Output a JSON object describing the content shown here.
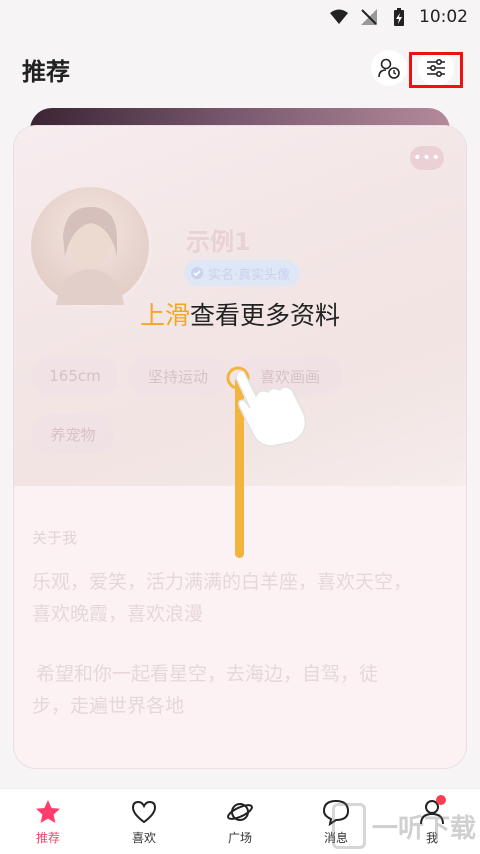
{
  "status_bar": {
    "time": "10:02"
  },
  "header": {
    "title": "推荐"
  },
  "card": {
    "name": "示例1",
    "verify_badge": "实名·真实头像",
    "tags": [
      "165cm",
      "坚持运动",
      "喜欢画画",
      "养宠物"
    ],
    "about_title": "关于我",
    "bio_lines": [
      "乐观，爱笑，活力满满的白羊座，喜欢天空，",
      "喜欢晚霞，喜欢浪漫",
      "希望和你一起看星空，去海边，自驾，徒",
      "步，走遍世界各地"
    ]
  },
  "guide": {
    "highlight": "上滑",
    "rest": "查看更多资料"
  },
  "tabs": [
    {
      "label": "推荐",
      "icon": "star-icon"
    },
    {
      "label": "喜欢",
      "icon": "heart-icon"
    },
    {
      "label": "广场",
      "icon": "planet-icon"
    },
    {
      "label": "消息",
      "icon": "chat-bubble-icon"
    },
    {
      "label": "我",
      "icon": "person-icon"
    }
  ],
  "colors": {
    "accent": "#ff3d6e",
    "guide_highlight": "#f5a623",
    "slide_line": "#f3b43e",
    "highlight_box": "#ee1111"
  },
  "watermark": {
    "text": "一听下载"
  }
}
